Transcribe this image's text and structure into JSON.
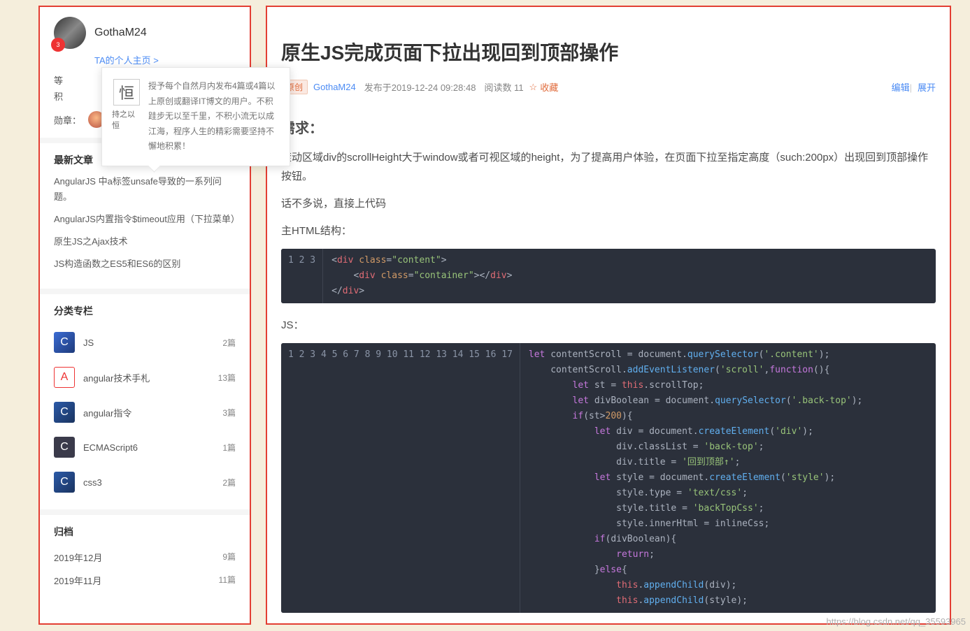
{
  "sidebar": {
    "username": "GothaM24",
    "avatar_badge": "3",
    "home_link": "TA的个人主页 >",
    "popover": {
      "icon_label": "持之以恒",
      "icon_glyph": "恒",
      "text": "授予每个自然月内发布4篇或4篇以上原创或翻译IT博文的用户。不积跬步无以至千里，不积小流无以成江海，程序人生的精彩需要坚持不懈地积累！"
    },
    "stats_prefix_1": "等",
    "stats_prefix_2": "积",
    "badges_label": "勋章：",
    "latest_header": "最新文章",
    "latest": [
      "AngularJS 中a标签unsafe导致的一系列问题。",
      "AngularJS内置指令$timeout应用（下拉菜单）",
      "原生JS之Ajax技术",
      "JS构造函数之ES5和ES6的区别"
    ],
    "cats_header": "分类专栏",
    "cats": [
      {
        "name": "JS",
        "count": "2篇",
        "icon": "ci-js",
        "letter": "C"
      },
      {
        "name": "angular技术手札",
        "count": "13篇",
        "icon": "ci-ang",
        "letter": "A"
      },
      {
        "name": "angular指令",
        "count": "3篇",
        "icon": "ci-cmd",
        "letter": "C"
      },
      {
        "name": "ECMAScript6",
        "count": "1篇",
        "icon": "ci-ecma",
        "letter": "C"
      },
      {
        "name": "css3",
        "count": "2篇",
        "icon": "ci-css",
        "letter": "C"
      }
    ],
    "archive_header": "归档",
    "archive": [
      {
        "label": "2019年12月",
        "count": "9篇"
      },
      {
        "label": "2019年11月",
        "count": "11篇"
      }
    ]
  },
  "article": {
    "title": "原生JS完成页面下拉出现回到顶部操作",
    "tag": "原创",
    "author": "GothaM24",
    "published": "发布于2019-12-24 09:28:48",
    "reads": "阅读数 11",
    "fav_icon": "☆",
    "fav": "收藏",
    "edit": "编辑",
    "expand": "展开",
    "h_need": "需求：",
    "p1": "滚动区域div的scrollHeight大于window或者可视区域的height，为了提高用户体验，在页面下拉至指定高度（such:200px）出现回到顶部操作按钮。",
    "p2": "话不多说，直接上代码",
    "p3": "主HTML结构：",
    "code1_lines": [
      "1",
      "2",
      "3"
    ],
    "p4": "JS：",
    "code2_lines": [
      "1",
      "2",
      "3",
      "4",
      "5",
      "6",
      "7",
      "8",
      "9",
      "10",
      "11",
      "12",
      "13",
      "14",
      "15",
      "16",
      "17"
    ]
  },
  "watermark": "https://blog.csdn.net/qq_35593965"
}
